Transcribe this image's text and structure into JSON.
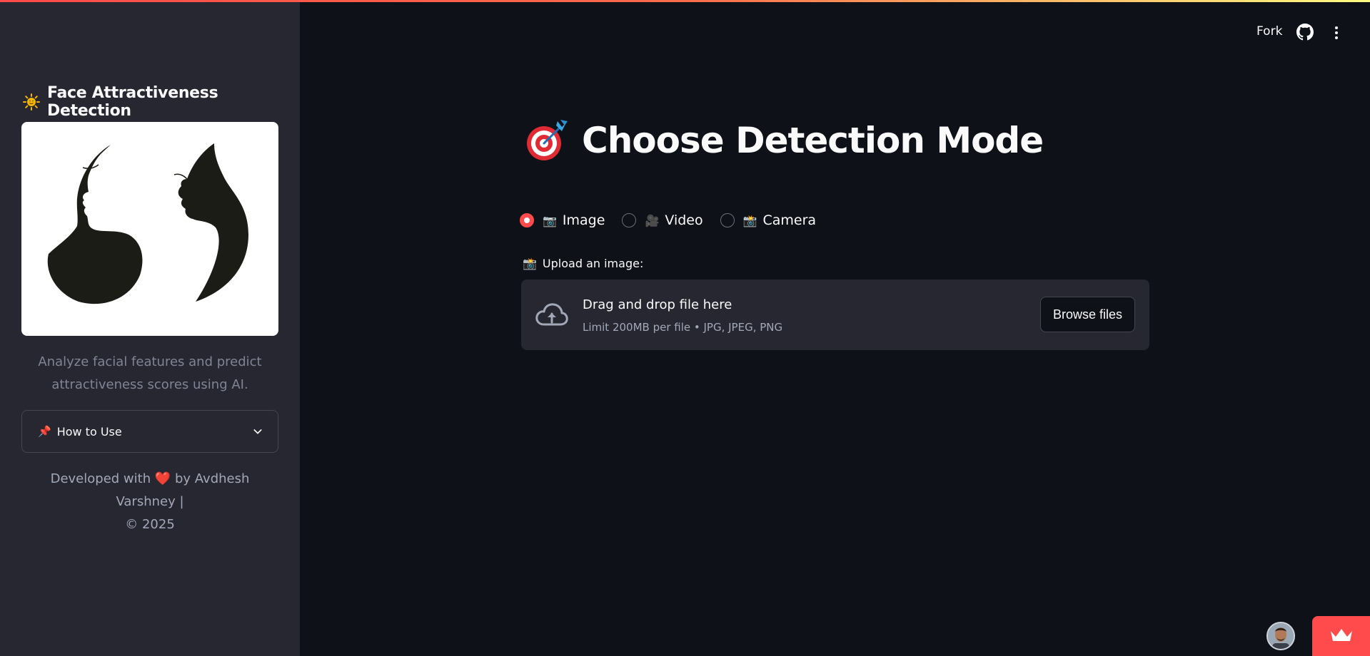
{
  "sidebar": {
    "title": "Face Attractiveness Detection",
    "title_icon": "sun-icon",
    "image_icon": "face-silhouettes-image",
    "description": "Analyze facial features and predict attractiveness scores using AI.",
    "expander": {
      "emoji": "📌",
      "label": "How to Use",
      "icon": "chevron-down-icon"
    },
    "footer": {
      "prefix": "Developed with",
      "heart": "❤️",
      "suffix": "by Avdhesh Varshney |",
      "copyright": "© 2025"
    }
  },
  "header": {
    "fork_label": "Fork",
    "github_icon": "github-icon",
    "menu_icon": "kebab-menu-icon"
  },
  "main": {
    "title_emoji": "target-icon",
    "title": "Choose Detection Mode",
    "radio_options": [
      {
        "emoji": "📷",
        "label": "Image",
        "selected": true
      },
      {
        "emoji": "🎥",
        "label": "Video",
        "selected": false
      },
      {
        "emoji": "📸",
        "label": "Camera",
        "selected": false
      }
    ],
    "uploader": {
      "emoji": "📸",
      "label": "Upload an image:",
      "drag_text": "Drag and drop file here",
      "limit_text": "Limit 200MB per file • JPG, JPEG, PNG",
      "browse_label": "Browse files",
      "cloud_icon": "cloud-upload-icon"
    }
  },
  "colors": {
    "background": "#0e1117",
    "sidebar": "#262730",
    "accent": "#ff4b4b",
    "muted_text": "#808495"
  }
}
